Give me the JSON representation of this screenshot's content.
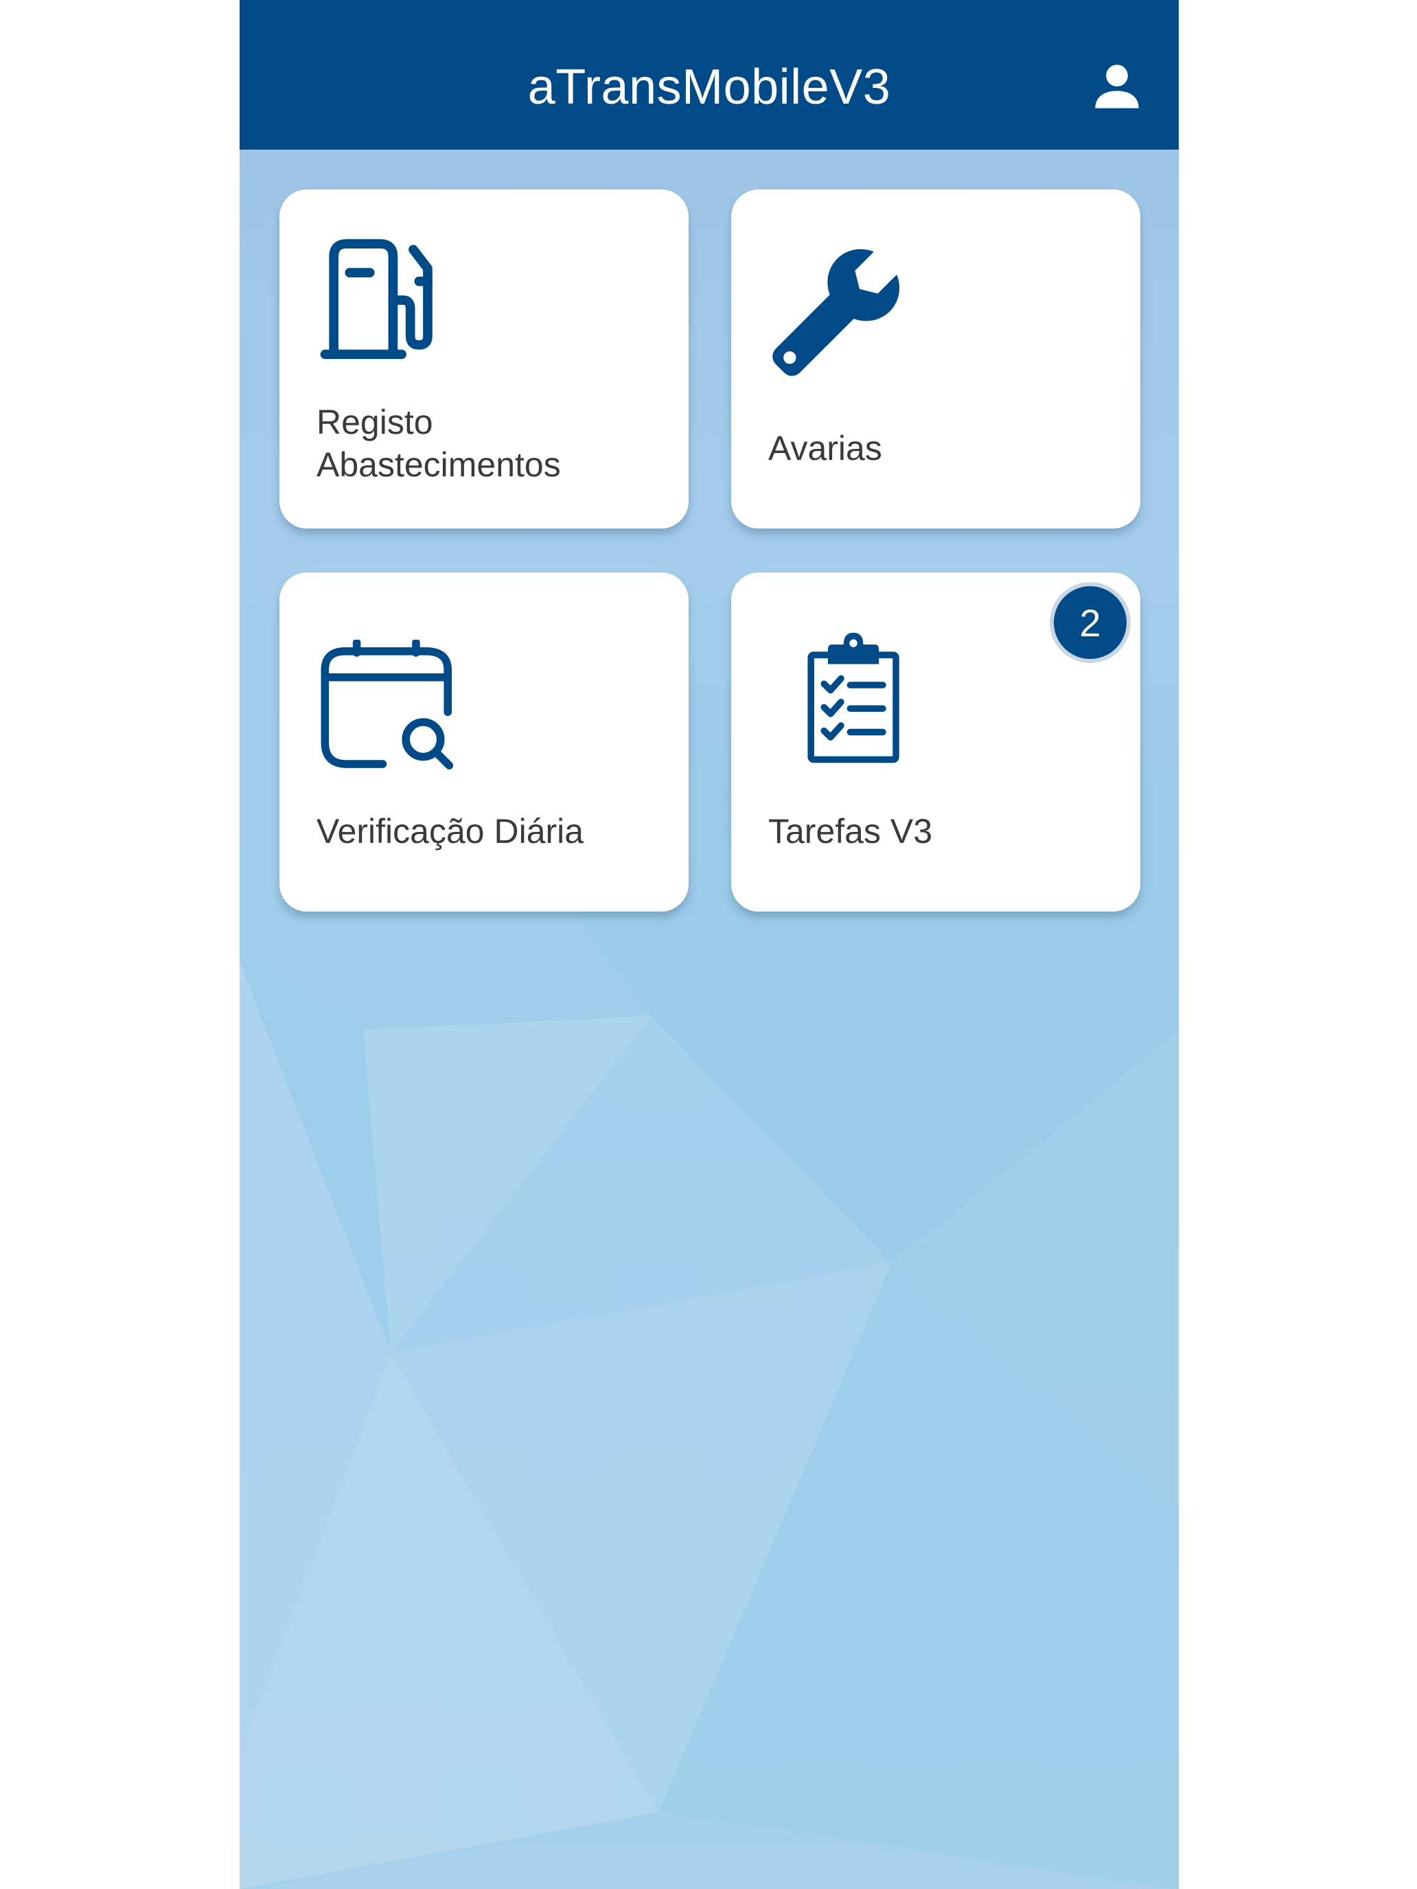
{
  "app": {
    "title": "aTransMobileV3"
  },
  "header": {
    "user_icon": "user-icon"
  },
  "tiles": [
    {
      "label": "Registo\nAbastecimentos",
      "icon": "fuel-pump-icon"
    },
    {
      "label": "Avarias",
      "icon": "wrench-icon"
    },
    {
      "label": "Verificação Diária",
      "icon": "calendar-search-icon"
    },
    {
      "label": "Tarefas V3",
      "icon": "clipboard-checklist-icon",
      "badge": "2"
    }
  ],
  "colors": {
    "primary": "#004b87",
    "background": "#9fcbe9",
    "tile": "#ffffff"
  }
}
